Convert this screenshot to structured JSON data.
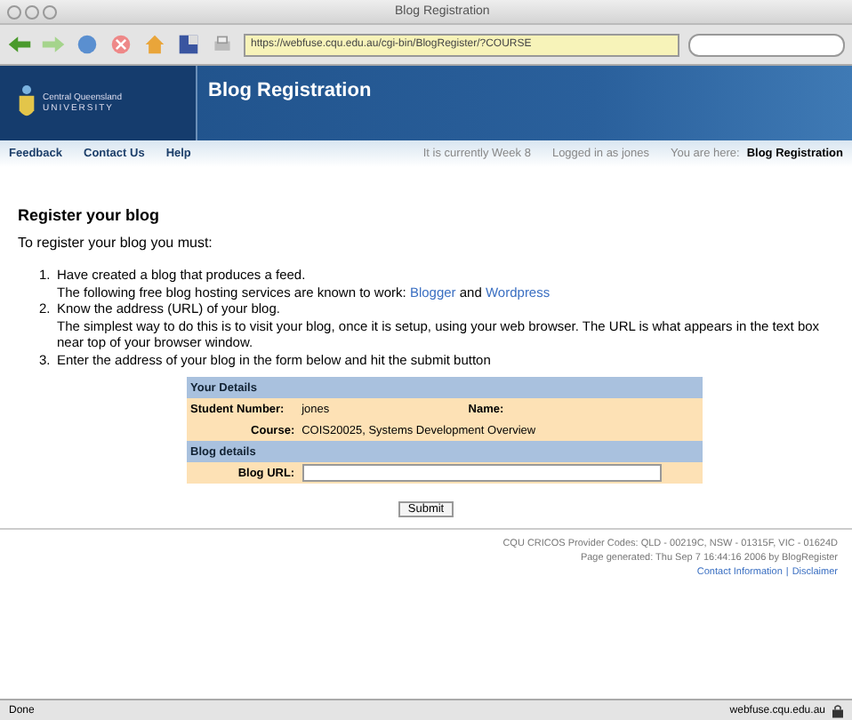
{
  "window": {
    "title": "Blog Registration"
  },
  "toolbar": {
    "url": "https://webfuse.cqu.edu.au/cgi-bin/BlogRegister/?COURSE"
  },
  "banner": {
    "logo_text": "Central Queensland",
    "logo_subtext": "UNIVERSITY",
    "title": "Blog Registration"
  },
  "nav": {
    "links": [
      "Feedback",
      "Contact Us",
      "Help"
    ],
    "status": [
      "It is currently Week 8",
      "Logged in as jones",
      "You are here:"
    ],
    "location": "Blog Registration"
  },
  "content": {
    "heading": "Register your blog",
    "intro": "To register your blog you must:",
    "steps": [
      {
        "number": "1.",
        "lines": [
          "Have created a blog that produces a feed.",
          "The following free blog hosting services are known to work: "
        ],
        "links": [
          "Blogger",
          "Wordpress"
        ],
        "joiner": " and "
      },
      {
        "number": "2.",
        "lines": [
          "Know the address (URL) of your blog.",
          "The simplest way to do this is to visit your blog, once it is setup, using your web browser. The URL is what appears in the text box near top of your browser window."
        ]
      },
      {
        "number": "3.",
        "lines": [
          "Enter the address of your blog in the form below and hit the submit button"
        ]
      }
    ]
  },
  "form": {
    "sections": [
      {
        "title": "Your Details"
      },
      {
        "title": "Blog details"
      }
    ],
    "student_label": "Student Number:",
    "student_value": "jones",
    "name_label": "Name:",
    "course_label": "Course:",
    "course_value": "COIS20025, Systems Development Overview",
    "url_label": "Blog URL:",
    "submit": "Submit"
  },
  "footer": [
    "CQU CRICOS Provider Codes: QLD - 00219C, NSW - 01315F, VIC - 01624D",
    "Page generated: Thu Sep 7 16:44:16 2006 by BlogRegister"
  ],
  "footer_links": [
    "Contact Information",
    "Disclaimer"
  ],
  "footer_separator": "|",
  "status_bar": {
    "left": "Done",
    "right": "webfuse.cqu.edu.au"
  }
}
